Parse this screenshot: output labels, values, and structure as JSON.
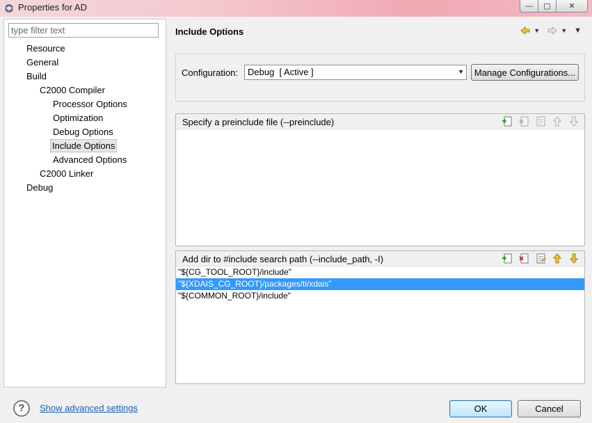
{
  "window": {
    "title": "Properties for AD",
    "controls": {
      "minimize": "—",
      "maximize": "▢",
      "close": "✕"
    }
  },
  "filter": {
    "placeholder": "type filter text",
    "value": ""
  },
  "tree": [
    {
      "label": "Resource",
      "level": 0,
      "selected": false
    },
    {
      "label": "General",
      "level": 0,
      "selected": false
    },
    {
      "label": "Build",
      "level": 0,
      "selected": false
    },
    {
      "label": "C2000 Compiler",
      "level": 1,
      "selected": false
    },
    {
      "label": "Processor Options",
      "level": 2,
      "selected": false
    },
    {
      "label": "Optimization",
      "level": 2,
      "selected": false
    },
    {
      "label": "Debug Options",
      "level": 2,
      "selected": false
    },
    {
      "label": "Include Options",
      "level": 2,
      "selected": true
    },
    {
      "label": "Advanced Options",
      "level": 2,
      "selected": false
    },
    {
      "label": "C2000 Linker",
      "level": 1,
      "selected": false
    },
    {
      "label": "Debug",
      "level": 0,
      "selected": false
    }
  ],
  "page": {
    "title": "Include Options"
  },
  "configuration": {
    "label": "Configuration:",
    "value": "Debug  [ Active ]",
    "manage_button": "Manage Configurations..."
  },
  "preinclude": {
    "label": "Specify a preinclude file (--preinclude)",
    "items": []
  },
  "include_paths": {
    "label": "Add dir to #include search path (--include_path, -I)",
    "items": [
      "\"${CG_TOOL_ROOT}/include\"",
      "\"${XDAIS_CG_ROOT}/packages/ti/xdais\"",
      "\"${COMMON_ROOT}/include\""
    ],
    "selected_index": 1
  },
  "footer": {
    "help_icon": "?",
    "advanced_link": "Show advanced settings",
    "ok": "OK",
    "cancel": "Cancel"
  },
  "colors": {
    "selection": "#3399ff",
    "link": "#1a5fb4"
  }
}
